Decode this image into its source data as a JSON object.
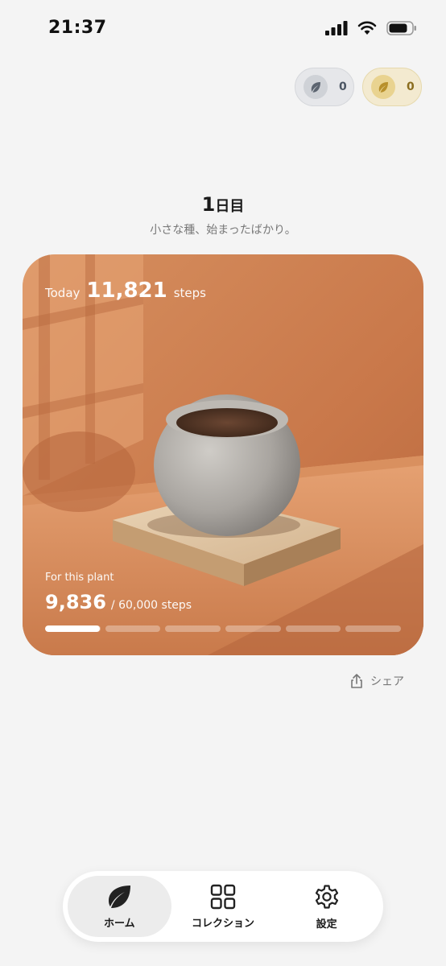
{
  "status_bar": {
    "time": "21:37"
  },
  "currencies": [
    {
      "name": "silver-leaf",
      "value": "0",
      "color": "#5c6470"
    },
    {
      "name": "gold-leaf",
      "value": "0",
      "color": "#b8902b"
    }
  ],
  "day": {
    "number": "1",
    "suffix": "日目",
    "subtitle": "小さな種、始まったばかり。"
  },
  "card": {
    "today_label": "Today",
    "today_steps": "11,821",
    "today_unit": "steps",
    "plant_label": "For this plant",
    "plant_current": "9,836",
    "plant_goal": "/ 60,000 steps",
    "progress_fraction": 0.164,
    "segment_count": 6
  },
  "share": {
    "label": "シェア"
  },
  "tabs": [
    {
      "label": "ホーム",
      "icon": "leaf-icon",
      "active": true
    },
    {
      "label": "コレクション",
      "icon": "grid-icon",
      "active": false
    },
    {
      "label": "設定",
      "icon": "gear-icon",
      "active": false
    }
  ]
}
